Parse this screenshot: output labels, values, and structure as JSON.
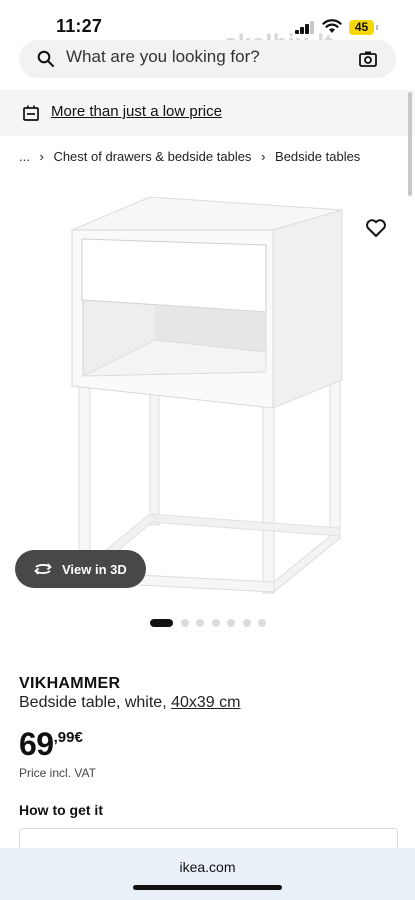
{
  "status": {
    "time": "11:27",
    "battery": "45",
    "watermark": "skelbiu.lt"
  },
  "search": {
    "placeholder": "What are you looking for?"
  },
  "promo": {
    "text": "More than just a low price"
  },
  "breadcrumb": {
    "ellipsis": "...",
    "items": [
      "Chest of drawers & bedside tables",
      "Bedside tables"
    ]
  },
  "gallery": {
    "view3d_label": "View in 3D",
    "dot_count": 7,
    "active_index": 0
  },
  "product": {
    "name": "VIKHAMMER",
    "description": "Bedside table, white,",
    "size": "40x39 cm",
    "price_int": "69",
    "price_dec": ",99€",
    "vat_note": "Price incl. VAT"
  },
  "delivery": {
    "title": "How to get it"
  },
  "browser": {
    "url": "ikea.com"
  },
  "colors": {
    "accent": "#111111",
    "battery": "#f5d70a",
    "pill": "#484848",
    "url_bar": "#e9f0f8"
  }
}
